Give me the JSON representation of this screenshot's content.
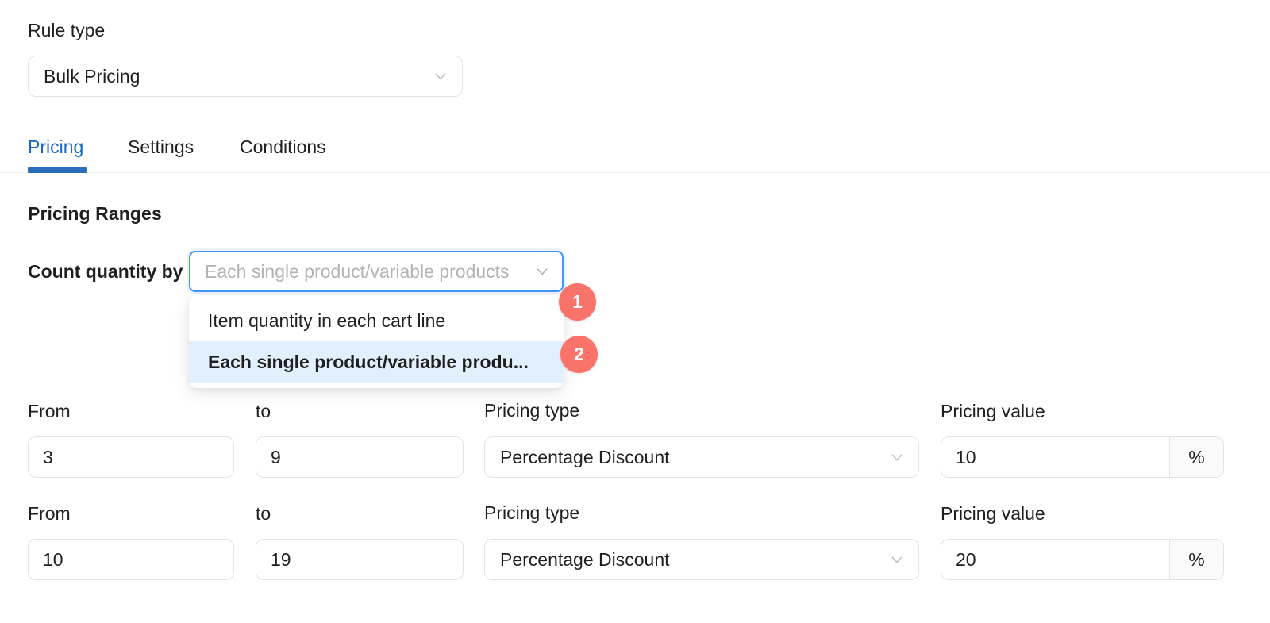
{
  "rule_type": {
    "label": "Rule type",
    "value": "Bulk Pricing"
  },
  "tabs": [
    {
      "label": "Pricing",
      "active": true
    },
    {
      "label": "Settings",
      "active": false
    },
    {
      "label": "Conditions",
      "active": false
    }
  ],
  "section": {
    "title": "Pricing Ranges"
  },
  "count_quantity": {
    "label": "Count quantity by",
    "placeholder": "Each single product/variable products",
    "value": "",
    "options": [
      {
        "label": "Item quantity in each cart line",
        "selected": false
      },
      {
        "label": "Each single product/variable produ...",
        "selected": true
      }
    ]
  },
  "badges": [
    {
      "number": "1"
    },
    {
      "number": "2"
    }
  ],
  "columns": {
    "from": "From",
    "to": "to",
    "pricing_type": "Pricing type",
    "pricing_value": "Pricing value"
  },
  "ranges": [
    {
      "from": "3",
      "to": "9",
      "pricing_type": "Percentage Discount",
      "pricing_value": "10",
      "suffix": "%"
    },
    {
      "from": "10",
      "to": "19",
      "pricing_type": "Percentage Discount",
      "pricing_value": "20",
      "suffix": "%"
    }
  ],
  "colors": {
    "accent_blue": "#1668c7",
    "tab_underline": "#2a6ebb",
    "focus_border": "#4096ff",
    "badge_red": "#f9736b",
    "option_selected_bg": "#e2effc",
    "border_gray": "#e3e3e6",
    "placeholder_gray": "#b3b3b6"
  }
}
